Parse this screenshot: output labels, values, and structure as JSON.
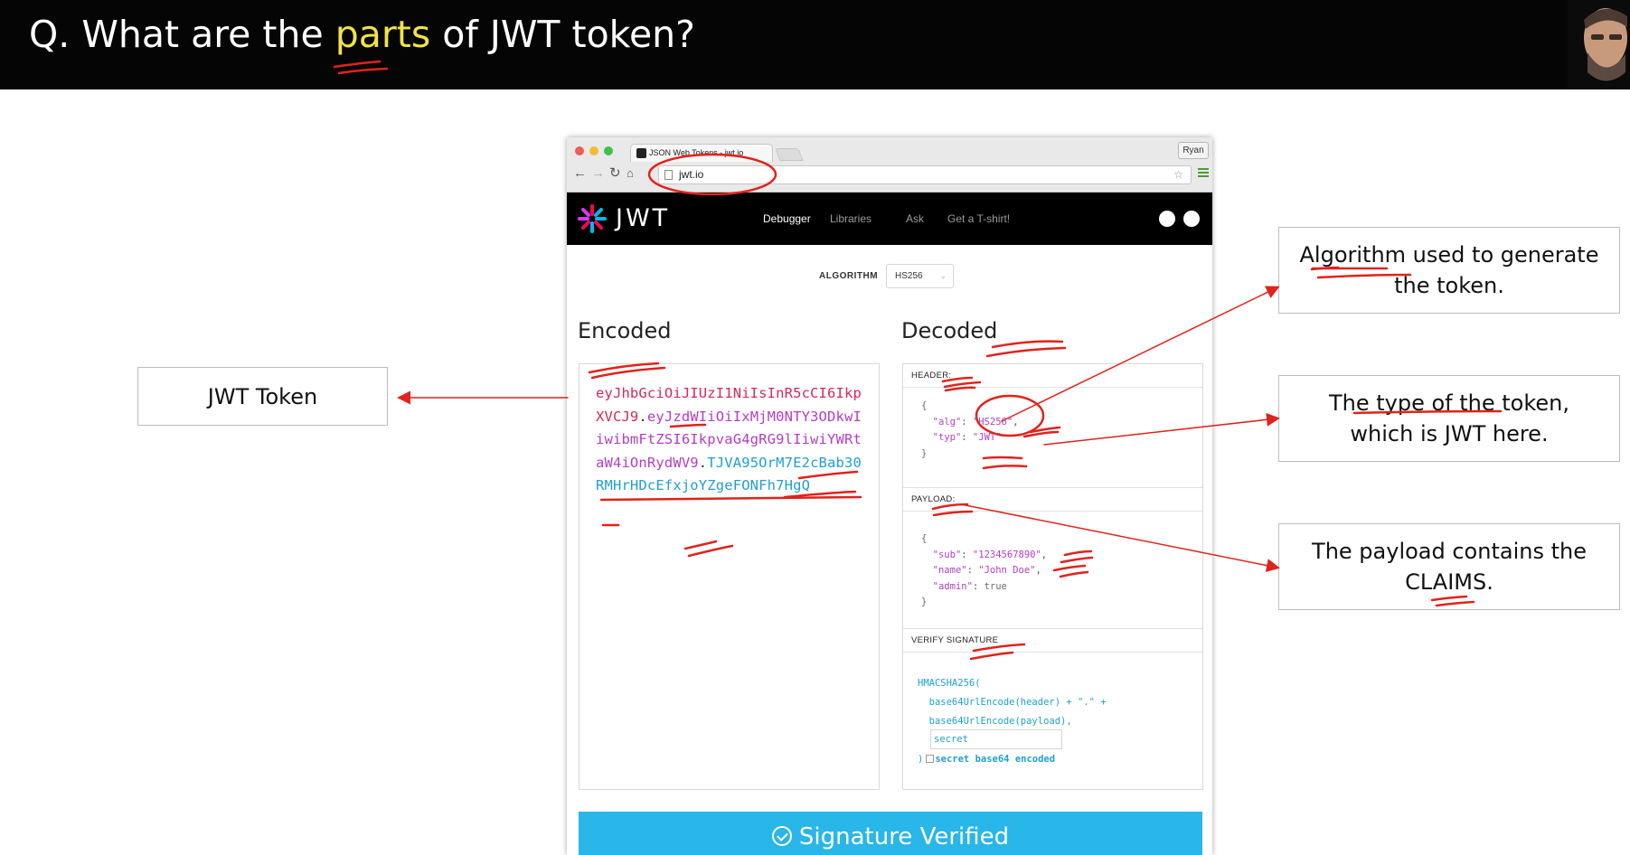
{
  "slide": {
    "title_prefix": "Q. What are the ",
    "title_highlight": "parts",
    "title_suffix": " of JWT token?"
  },
  "annotations": {
    "jwt_token": "JWT Token",
    "algorithm": "Algorithm used to generate the token.",
    "type": "The type of the token, which is JWT here.",
    "payload": "The payload contains the CLAIMS."
  },
  "browser": {
    "tab_title": "JSON Web Tokens - jwt.io",
    "profile": "Ryan",
    "url": "jwt.io"
  },
  "site": {
    "logo": "JWT",
    "nav": [
      "Debugger",
      "Libraries",
      "Ask",
      "Get a T-shirt!"
    ]
  },
  "algorithm": {
    "label": "ALGORITHM",
    "value": "HS256"
  },
  "encoded": {
    "heading": "Encoded",
    "header_part": "eyJhbGciOiJIUzI1NiIsInR5cCI6IkpXVCJ9",
    "dot": ".",
    "payload_part": "eyJzdWIiOiIxMjM0NTY3ODkwIiwibmFtZSI6IkpvaG4gRG9lIiwiYWRtaW4iOnRydWV9",
    "signature_part": "TJVA95OrM7E2cBab30RMHrHDcEfxjoYZgeFONFh7HgQ"
  },
  "decoded": {
    "heading": "Decoded",
    "header_label": "HEADER:",
    "header_json": {
      "open": "{",
      "alg_key": "\"alg\"",
      "alg_val": "\"HS256\"",
      "typ_key": "\"typ\"",
      "typ_val": "\"JWT\"",
      "close": "}"
    },
    "payload_label": "PAYLOAD:",
    "payload_json": {
      "open": "{",
      "sub_key": "\"sub\"",
      "sub_val": "\"1234567890\"",
      "name_key": "\"name\"",
      "name_val": "\"John Doe\"",
      "admin_key": "\"admin\"",
      "admin_val": "true",
      "close": "}"
    },
    "signature_label": "VERIFY SIGNATURE",
    "sig_line1": "HMACSHA256(",
    "sig_line2": "  base64UrlEncode(header) + \".\" +",
    "sig_line3": "  base64UrlEncode(payload),",
    "secret_value": "secret",
    "sig_close": ")",
    "b64_label": "secret base64 encoded"
  },
  "status": {
    "verified": "Signature Verified"
  },
  "colors": {
    "header_red": "#d6275b",
    "payload_purple": "#b43ec3",
    "signature_blue": "#1fa0d0",
    "annotation_red": "#e0231c"
  }
}
